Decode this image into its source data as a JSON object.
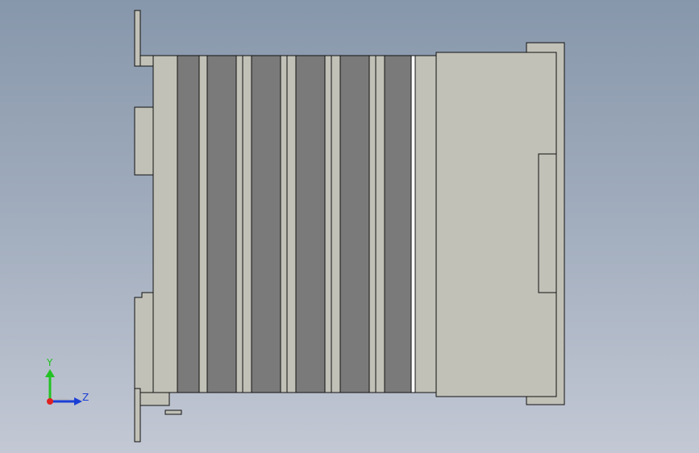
{
  "viewport": {
    "background_top": "#8797ab",
    "background_bottom": "#c3c8d4"
  },
  "model": {
    "body_color": "#c1c1b8",
    "fin_color": "#7a7a7a",
    "outline_color": "#111111",
    "fin_count": 6
  },
  "triad": {
    "y_label": "Y",
    "z_label": "Z",
    "y_color": "#22c222",
    "z_color": "#1a3fd6",
    "x_color": "#e02020"
  }
}
